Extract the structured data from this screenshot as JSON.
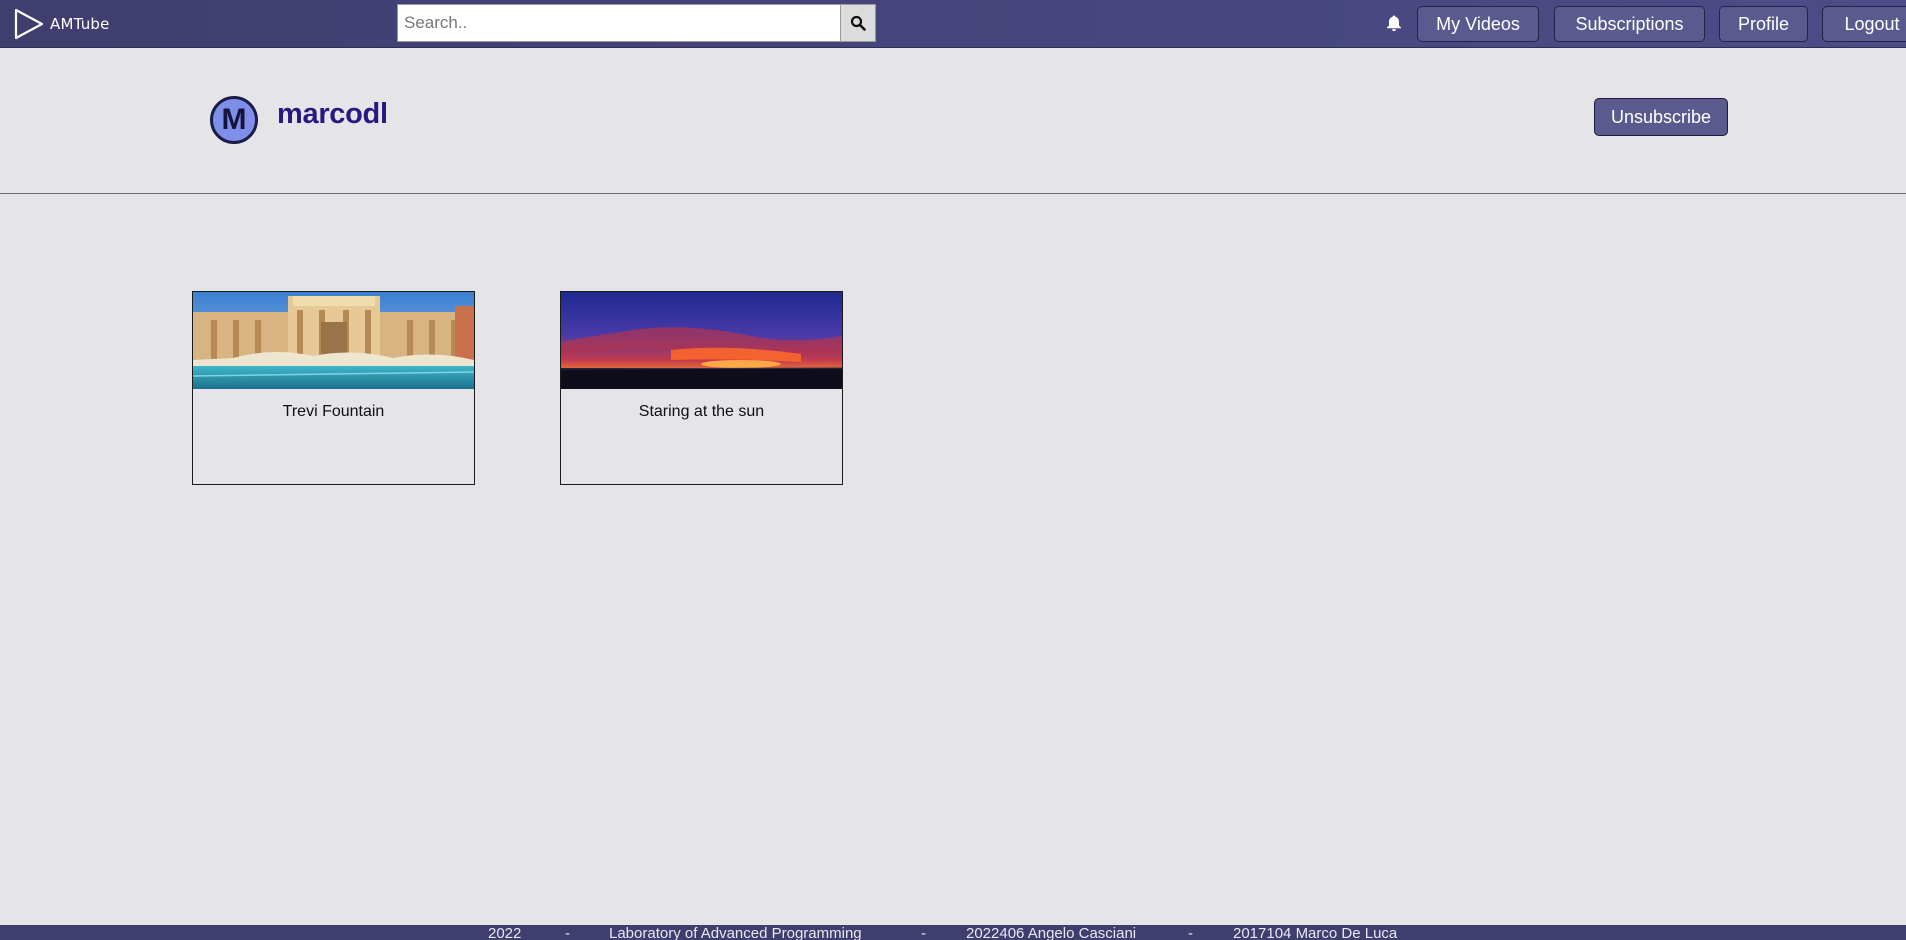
{
  "app": {
    "name": "AMTube"
  },
  "search": {
    "placeholder": "Search.."
  },
  "nav": {
    "my_videos": "My Videos",
    "subscriptions": "Subscriptions",
    "profile": "Profile",
    "logout": "Logout"
  },
  "icons": {
    "logo": "play-triangle-icon",
    "search": "search-icon",
    "notifications": "bell-icon"
  },
  "channel": {
    "avatar_letter": "M",
    "name": "marcodl",
    "unsubscribe_label": "Unsubscribe"
  },
  "videos": [
    {
      "title": "Trevi Fountain"
    },
    {
      "title": "Staring at the sun"
    }
  ],
  "footer": {
    "year": "2022",
    "course": "Laboratory of Advanced Programming",
    "author1": "2022406 Angelo Casciani",
    "author2": "2017104 Marco De Luca",
    "sep": "-"
  },
  "colors": {
    "navbar": "#3f3e6e",
    "button": "#5b5a8e",
    "channel_name": "#2a1880",
    "page_bg": "#e4e4e9"
  }
}
